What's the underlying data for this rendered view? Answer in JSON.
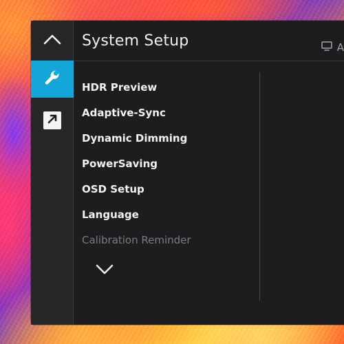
{
  "screen": {
    "title": "System Setup",
    "header_right_label": "A"
  },
  "icons": {
    "up": "chevron-up-icon",
    "support": "wrench-icon",
    "shortcut": "arrow-shortcut-icon",
    "source": "monitor-icon",
    "down": "chevron-down-icon"
  },
  "menu": {
    "items": [
      {
        "label": "HDR Preview"
      },
      {
        "label": "Adaptive-Sync"
      },
      {
        "label": "Dynamic Dimming"
      },
      {
        "label": "PowerSaving"
      },
      {
        "label": "OSD Setup"
      },
      {
        "label": "Language"
      },
      {
        "label": "Calibration Reminder"
      }
    ]
  },
  "colors": {
    "panel_bg": "#1d1d1f",
    "rail_bg": "#262628",
    "accent": "#14a6d8",
    "text": "#f2f2f2",
    "dim_text": "#7b7b80"
  }
}
